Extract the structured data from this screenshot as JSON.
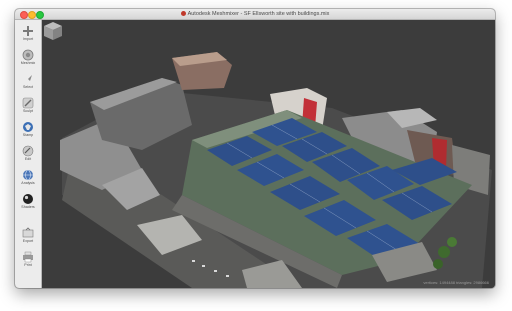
{
  "window": {
    "title": "Autodesk Meshmixer - SF Ellsworth site with buildings.mix"
  },
  "toolbar": {
    "items": [
      {
        "label": "Import",
        "icon": "plus-icon"
      },
      {
        "label": "Meshmix",
        "icon": "meshmix-sphere-icon"
      },
      {
        "label": "Select",
        "icon": "select-arrow-icon"
      },
      {
        "label": "Sculpt",
        "icon": "sculpt-brush-icon"
      },
      {
        "label": "Stamp",
        "icon": "stamp-icon"
      },
      {
        "label": "Edit",
        "icon": "edit-icon"
      },
      {
        "label": "Analysis",
        "icon": "analysis-globe-icon"
      },
      {
        "label": "Shaders",
        "icon": "shaders-sphere-icon"
      },
      {
        "label": "Export",
        "icon": "export-icon"
      },
      {
        "label": "Print",
        "icon": "print-icon"
      }
    ]
  },
  "viewport": {
    "status_text": "vertices: 1494488  triangles: 2986666",
    "viewcube_icon": "viewcube-icon"
  },
  "colors": {
    "viewport_bg": "#3c3c3c",
    "court_blue": "#2e4f8a",
    "court_green": "#4c7a58",
    "red_accent": "#b3262a"
  }
}
